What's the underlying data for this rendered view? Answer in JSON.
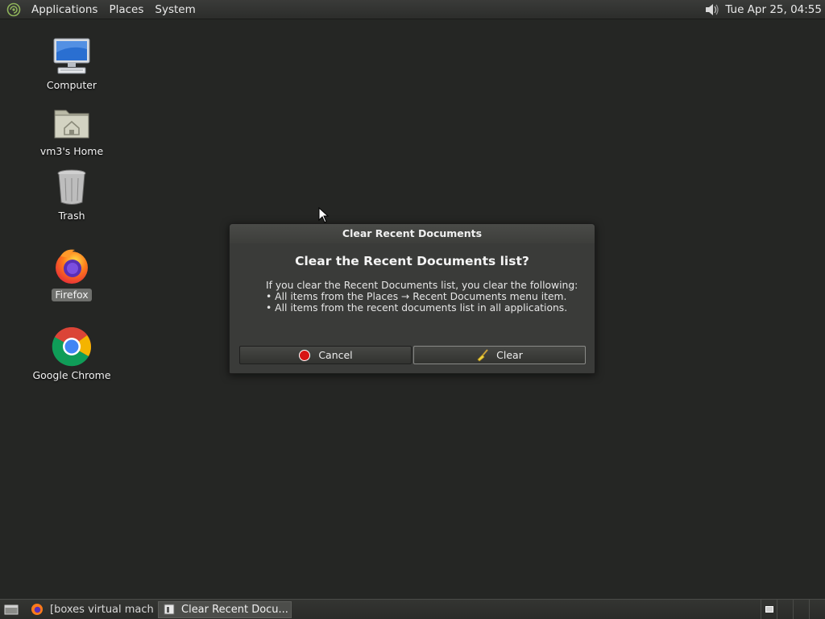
{
  "top_panel": {
    "menus": [
      "Applications",
      "Places",
      "System"
    ],
    "clock": "Tue Apr 25, 04:55"
  },
  "desktop_icons": [
    {
      "label": "Computer",
      "icon": "computer-icon"
    },
    {
      "label": "vm3's Home",
      "icon": "home-folder-icon"
    },
    {
      "label": "Trash",
      "icon": "trash-icon"
    },
    {
      "label": "Firefox",
      "icon": "firefox-icon"
    },
    {
      "label": "Google Chrome",
      "icon": "chrome-icon"
    }
  ],
  "dialog": {
    "title": "Clear Recent Documents",
    "heading": "Clear the Recent Documents list?",
    "body": [
      "If you clear the Recent Documents list, you clear the following:",
      "• All items from the Places → Recent Documents menu item.",
      "• All items from the recent documents list in all applications."
    ],
    "cancel_label": "Cancel",
    "clear_label": "Clear"
  },
  "taskbar": {
    "tasks": [
      {
        "label": "[boxes virtual machi...",
        "icon": "firefox-icon"
      },
      {
        "label": "Clear Recent Docu...",
        "icon": "dialog-window-icon"
      }
    ]
  },
  "colors": {
    "desktop_bg": "#252624",
    "panel_bg": "#2f302e",
    "dialog_bg": "#3a3b39"
  }
}
